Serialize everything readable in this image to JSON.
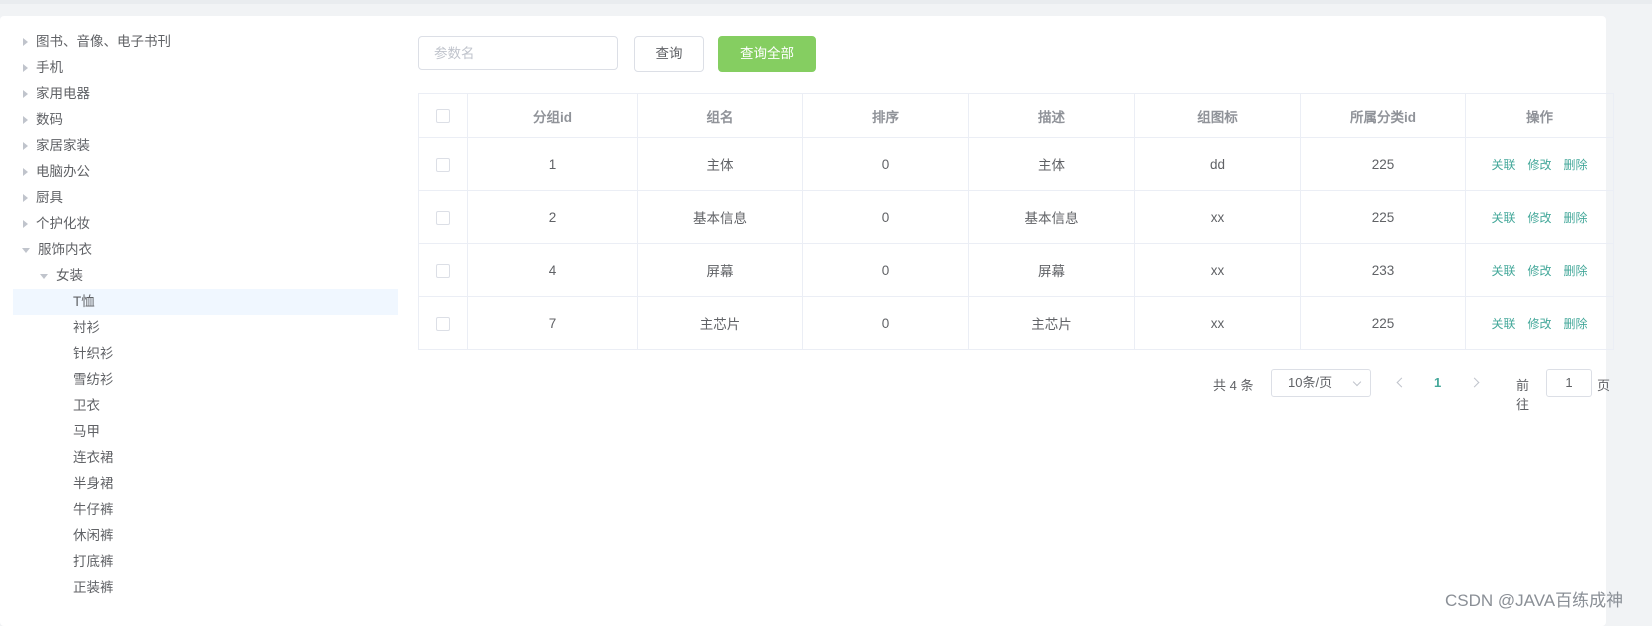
{
  "tree": {
    "categories": [
      {
        "label": "图书、音像、电子书刊",
        "expanded": false
      },
      {
        "label": "手机",
        "expanded": false
      },
      {
        "label": "家用电器",
        "expanded": false
      },
      {
        "label": "数码",
        "expanded": false
      },
      {
        "label": "家居家装",
        "expanded": false
      },
      {
        "label": "电脑办公",
        "expanded": false
      },
      {
        "label": "厨具",
        "expanded": false
      },
      {
        "label": "个护化妆",
        "expanded": false
      },
      {
        "label": "服饰内衣",
        "expanded": true
      }
    ],
    "sub_category": {
      "label": "女装",
      "expanded": true
    },
    "leaves": [
      "T恤",
      "衬衫",
      "针织衫",
      "雪纺衫",
      "卫衣",
      "马甲",
      "连衣裙",
      "半身裙",
      "牛仔裤",
      "休闲裤",
      "打底裤",
      "正装裤"
    ],
    "selected_leaf": "T恤"
  },
  "search": {
    "placeholder": "参数名",
    "value": ""
  },
  "buttons": {
    "query": "查询",
    "query_all": "查询全部"
  },
  "table": {
    "headers": [
      "分组id",
      "组名",
      "排序",
      "描述",
      "组图标",
      "所属分类id",
      "操作"
    ],
    "rows": [
      {
        "id": "1",
        "name": "主体",
        "sort": "0",
        "desc": "主体",
        "icon": "dd",
        "catelog_id": "225"
      },
      {
        "id": "2",
        "name": "基本信息",
        "sort": "0",
        "desc": "基本信息",
        "icon": "xx",
        "catelog_id": "225"
      },
      {
        "id": "4",
        "name": "屏幕",
        "sort": "0",
        "desc": "屏幕",
        "icon": "xx",
        "catelog_id": "233"
      },
      {
        "id": "7",
        "name": "主芯片",
        "sort": "0",
        "desc": "主芯片",
        "icon": "xx",
        "catelog_id": "225"
      }
    ],
    "actions": [
      "关联",
      "修改",
      "删除"
    ]
  },
  "pagination": {
    "total": "共 4 条",
    "page_size": "10条/页",
    "current_page": "1",
    "goto_label": "前往",
    "goto_value": "1",
    "page_unit": "页"
  },
  "watermark": "CSDN @JAVA百练成神",
  "colors": {
    "primary": "#44a89a",
    "success": "#85ce61",
    "border": "#ebeef5",
    "selected_bg": "#f0f7ff"
  }
}
